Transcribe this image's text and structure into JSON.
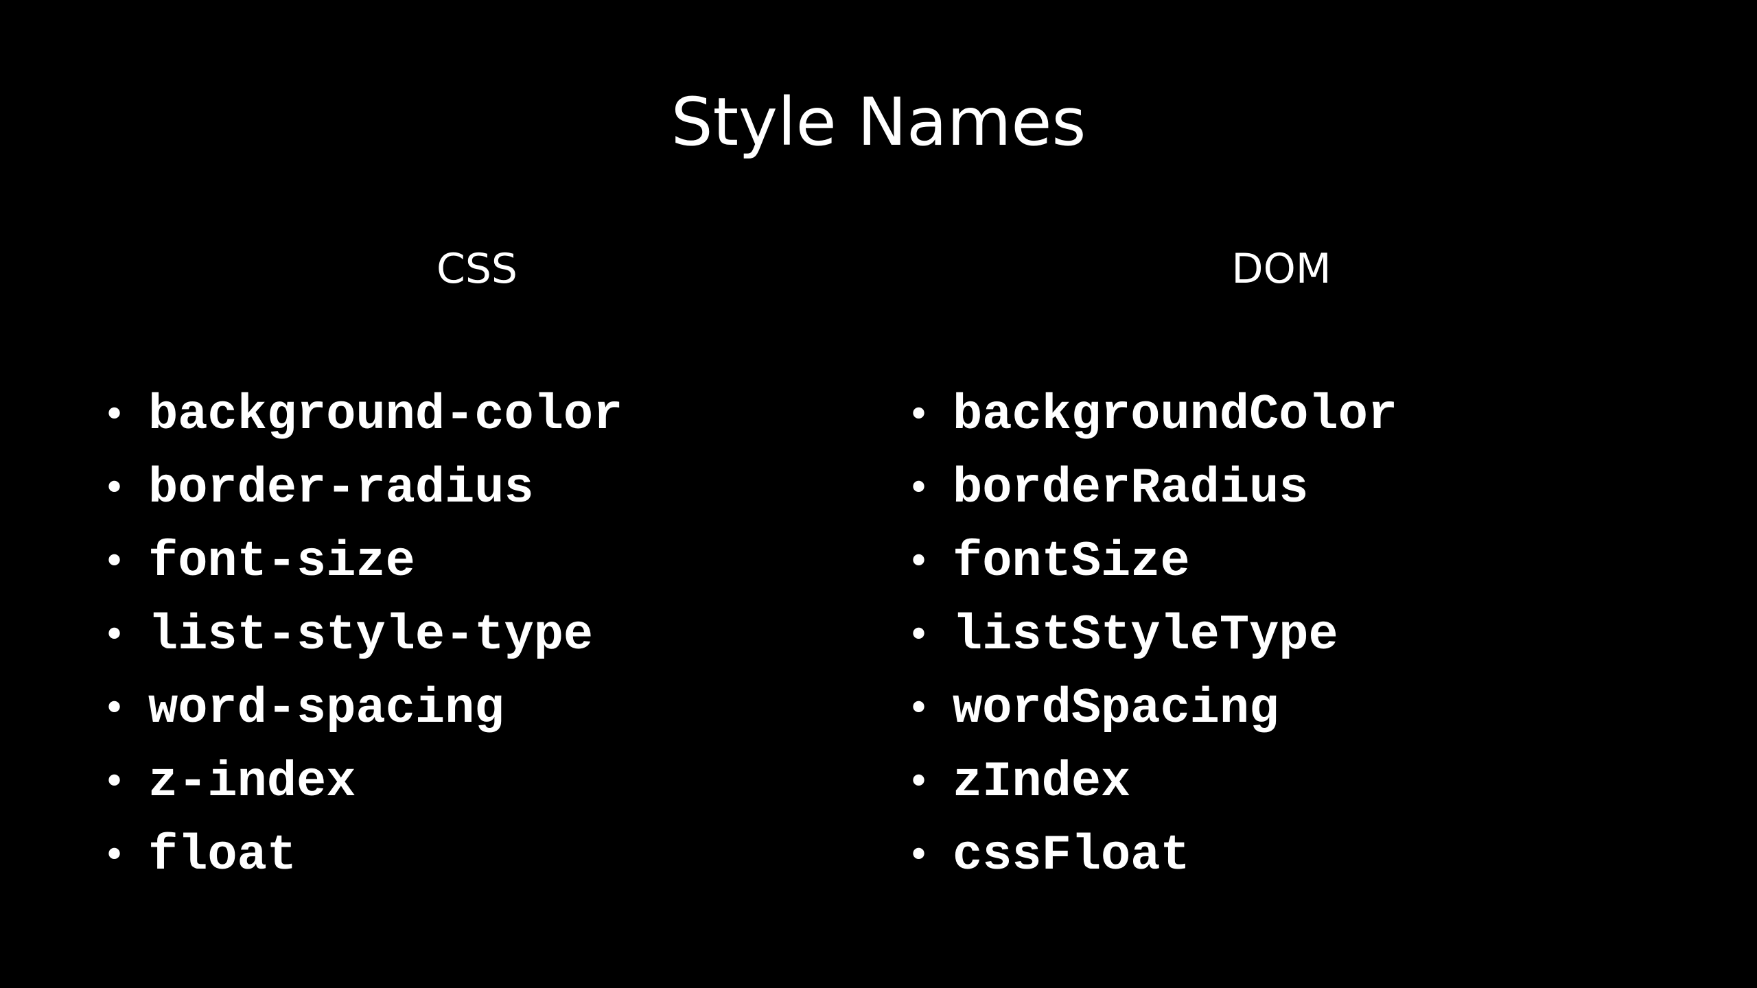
{
  "slide": {
    "title": "Style Names",
    "columns": [
      {
        "header": "CSS",
        "items": [
          "background-color",
          "border-radius",
          "font-size",
          "list-style-type",
          "word-spacing",
          "z-index",
          "float"
        ]
      },
      {
        "header": "DOM",
        "items": [
          "backgroundColor",
          "borderRadius",
          "fontSize",
          "listStyleType",
          "wordSpacing",
          "zIndex",
          "cssFloat"
        ]
      }
    ],
    "bullet_char": "•"
  },
  "colors": {
    "background": "#000000",
    "text": "#ffffff"
  }
}
